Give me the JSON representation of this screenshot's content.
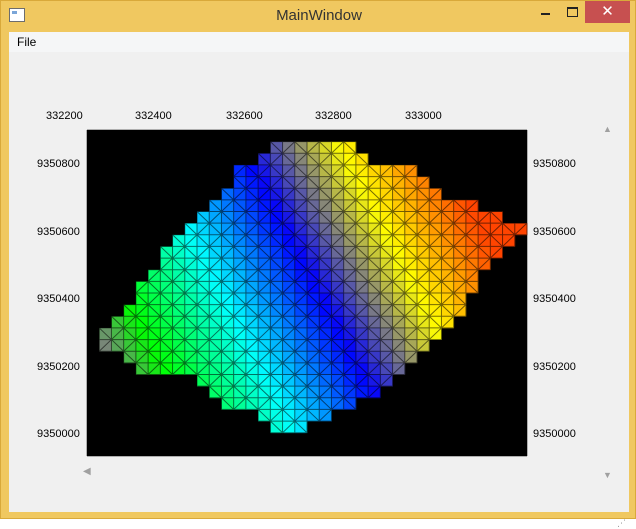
{
  "window": {
    "title": "MainWindow",
    "minimize_label": "",
    "maximize_label": "",
    "close_label": "✕"
  },
  "menu": {
    "file": "File"
  },
  "plot": {
    "x_ticks": [
      "332200",
      "332400",
      "332600",
      "332800",
      "333000"
    ],
    "y_ticks": [
      "9350800",
      "9350600",
      "9350400",
      "9350200",
      "9350000"
    ],
    "mesh_color": "#000000",
    "colormap": [
      "#ff00ff",
      "#00ff00",
      "#00ffff",
      "#0000ff",
      "#ffff00",
      "#ff4400"
    ]
  },
  "scrollbars": {
    "up": "▲",
    "down": "▼",
    "left": "◀"
  }
}
